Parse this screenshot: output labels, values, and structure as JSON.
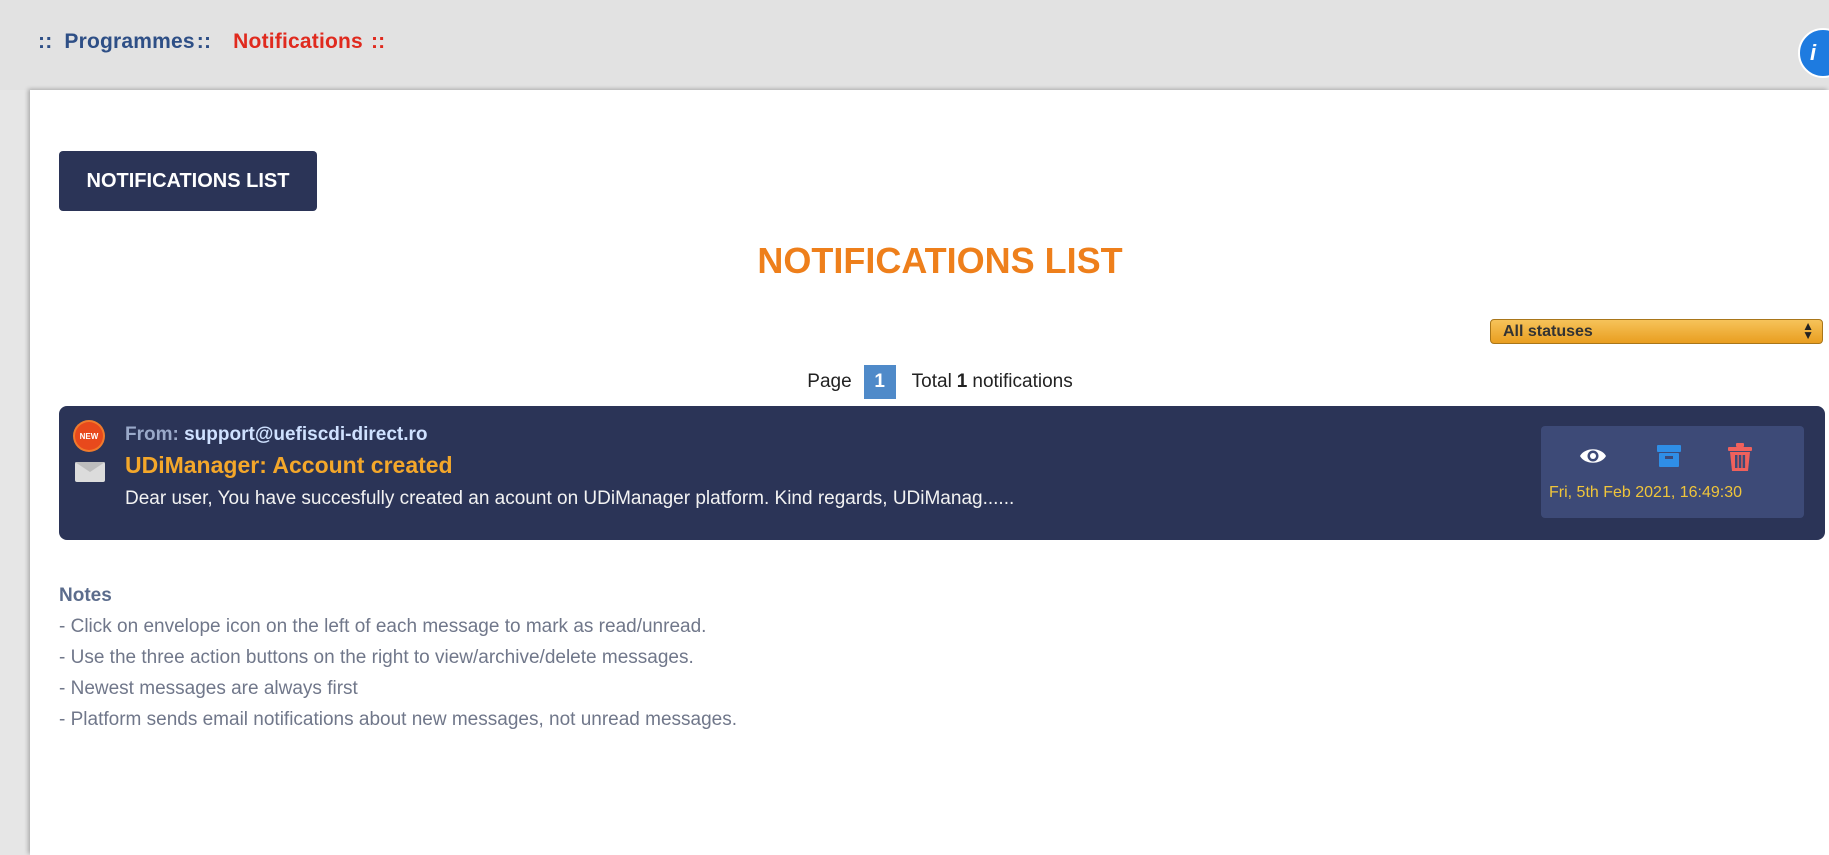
{
  "breadcrumb": {
    "sep_start": "::",
    "programmes": "Programmes",
    "sep_mid": "::",
    "current": "Notifications",
    "sep_end": "::"
  },
  "user_avatar": {
    "letter": "i"
  },
  "tab": {
    "label": "NOTIFICATIONS LIST"
  },
  "page_title": "NOTIFICATIONS LIST",
  "status_filter": {
    "selected": "All statuses"
  },
  "pager": {
    "page_label": "Page",
    "current_page": "1",
    "total_label": "Total",
    "total_count": "1",
    "total_suffix": "notifications"
  },
  "notifications": [
    {
      "badge": "NEW",
      "from_label": "From:",
      "from_email": "support@uefiscdi-direct.ro",
      "subject": "UDiManager: Account created",
      "preview": "Dear user, You have succesfully created an acount on UDiManager platform. Kind regards, UDiManag......",
      "date": "Fri, 5th Feb 2021, 16:49:30"
    }
  ],
  "notes": {
    "title": "Notes",
    "lines": [
      "- Click on envelope icon on the left of each message to mark as read/unread.",
      "- Use the three action buttons on the right to view/archive/delete messages.",
      "- Newest messages are always first",
      "- Platform sends email notifications about new messages, not unread messages."
    ]
  },
  "colors": {
    "brand_dark": "#2b3457",
    "accent_orange": "#ee7f1b",
    "breadcrumb_blue": "#2e4f86",
    "breadcrumb_active": "#e02a1e",
    "page_blue": "#4f8ac9"
  },
  "icons": {
    "new": "new-badge-icon",
    "envelope": "envelope-icon",
    "view": "eye-icon",
    "archive": "archive-icon",
    "delete": "trash-icon"
  }
}
